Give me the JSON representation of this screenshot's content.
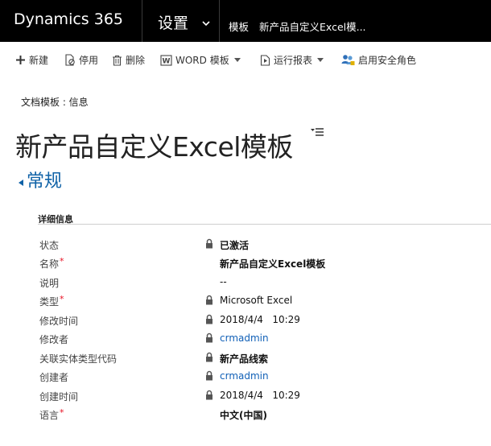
{
  "nav": {
    "brand": "Dynamics 365",
    "area": "设置",
    "crumb_entity": "模板",
    "crumb_record": "新产品自定义Excel模..."
  },
  "commands": {
    "new": "新建",
    "deactivate": "停用",
    "delete": "删除",
    "word_template": "WORD 模板",
    "run_report": "运行报表",
    "enable_security_roles": "启用安全角色"
  },
  "header": {
    "entity_label": "文档模板 : 信息",
    "title": "新产品自定义Excel模板"
  },
  "section": {
    "title": "常规",
    "group_title": "详细信息"
  },
  "fields": [
    {
      "label": "状态",
      "required": "",
      "value": "已激活"
    },
    {
      "label": "名称",
      "required": "*",
      "value": "新产品自定义Excel模板"
    },
    {
      "label": "说明",
      "required": "",
      "value": "--"
    },
    {
      "label": "类型",
      "required": "*",
      "value": "Microsoft Excel"
    },
    {
      "label": "修改时间",
      "required": "",
      "value": "2018/4/4   10:29"
    },
    {
      "label": "修改者",
      "required": "",
      "value": "crmadmin"
    },
    {
      "label": "关联实体类型代码",
      "required": "",
      "value": "新产品线索"
    },
    {
      "label": "创建者",
      "required": "",
      "value": "crmadmin"
    },
    {
      "label": "创建时间",
      "required": "",
      "value": "2018/4/4   10:29"
    },
    {
      "label": "语言",
      "required": "*",
      "value": "中文(中国)"
    }
  ],
  "colors": {
    "nav_bg": "#000000",
    "section_title": "#0f62a7",
    "link": "#1160b7",
    "required": "#e81123"
  }
}
